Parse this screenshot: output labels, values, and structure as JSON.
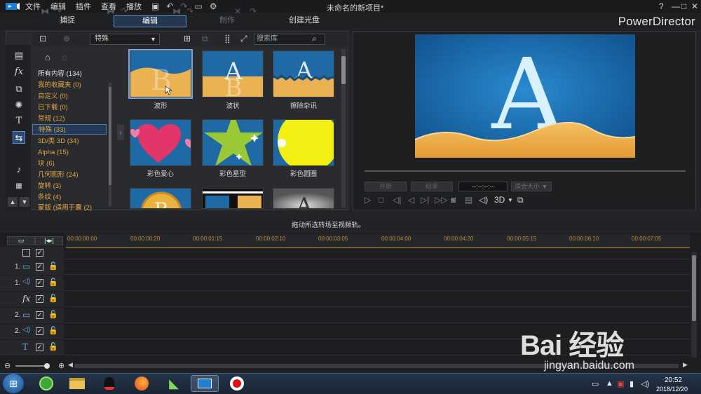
{
  "app": {
    "document_title": "未命名的新项目*",
    "brand": "PowerDirector",
    "menu": [
      "文件",
      "编辑",
      "插件",
      "查看",
      "播放"
    ],
    "window_buttons": [
      "?",
      "—",
      "□",
      "✕"
    ]
  },
  "modes": [
    {
      "label": "捕捉",
      "state": "normal"
    },
    {
      "label": "编辑",
      "state": "active"
    },
    {
      "label": "制作",
      "state": "disabled"
    },
    {
      "label": "创建光盘",
      "state": "normal"
    }
  ],
  "library": {
    "category_select": "特殊",
    "search_placeholder": "搜索库",
    "categories": [
      {
        "label": "所有内容 (134)",
        "tone": "white"
      },
      {
        "label": "我的收藏夹 (0)",
        "tone": "orange"
      },
      {
        "label": "自定义 (0)",
        "tone": "orange"
      },
      {
        "label": "已下载 (0)",
        "tone": "orange"
      },
      {
        "label": "常规 (12)",
        "tone": "orange"
      },
      {
        "label": "特殊 (33)",
        "tone": "selected"
      },
      {
        "label": "3D/类 3D (34)",
        "tone": "orange"
      },
      {
        "label": "Alpha (15)",
        "tone": "orange"
      },
      {
        "label": "块 (6)",
        "tone": "orange"
      },
      {
        "label": "几何图形 (24)",
        "tone": "orange"
      },
      {
        "label": "旋转 (3)",
        "tone": "orange"
      },
      {
        "label": "条纹 (4)",
        "tone": "orange"
      },
      {
        "label": "蒙版 (适用于囊",
        "tone": "orange"
      }
    ],
    "categories_last_count": "(2)",
    "transitions": [
      {
        "label": "波形",
        "selected": true
      },
      {
        "label": "波状",
        "selected": false
      },
      {
        "label": "擦除杂讯",
        "selected": false
      },
      {
        "label": "彩色爱心",
        "selected": false
      },
      {
        "label": "彩色星型",
        "selected": false
      },
      {
        "label": "彩色圆圈",
        "selected": false
      },
      {
        "label": "",
        "selected": false
      },
      {
        "label": "",
        "selected": false
      },
      {
        "label": "",
        "selected": false
      }
    ],
    "thumb_letters": {
      "a": "A",
      "b": "B"
    }
  },
  "preview": {
    "letter": "A",
    "start_label": "开始",
    "end_label": "结束",
    "timecode": "--:--:--:--",
    "fit_label": "适合大小",
    "mode_3d": "3D"
  },
  "timeline": {
    "hint": "拖动所选转场至视频轨。",
    "ruler_ticks": [
      "00:00:00:00",
      "00:00:00:20",
      "00:00:01:15",
      "00:00:02:10",
      "00:00:03:05",
      "00:00:04:00",
      "00:00:04:20",
      "00:00:05:15",
      "00:00:06:10",
      "00:00:07:05"
    ],
    "tracks": [
      {
        "num": "1.",
        "icon": "video-track-icon",
        "glyph": "▭"
      },
      {
        "num": "1.",
        "icon": "audio-track-icon",
        "glyph": "◁)"
      },
      {
        "num": "",
        "icon": "fx-track-icon",
        "glyph": "fx"
      },
      {
        "num": "2.",
        "icon": "video-track-icon",
        "glyph": "▭"
      },
      {
        "num": "2.",
        "icon": "audio-track-icon",
        "glyph": "◁)"
      },
      {
        "num": "",
        "icon": "title-track-icon",
        "glyph": "T"
      }
    ]
  },
  "taskbar": {
    "time": "20:52",
    "date": "2018/12/20"
  },
  "watermark": {
    "logo": "Bai 经验",
    "url": "jingyan.baidu.com"
  },
  "colors": {
    "accent": "#5a8fd0",
    "category_orange": "#e0a540",
    "ruler": "#c08a3a",
    "preview_blue": "#1a6fb0",
    "sand": "#e9a640"
  }
}
